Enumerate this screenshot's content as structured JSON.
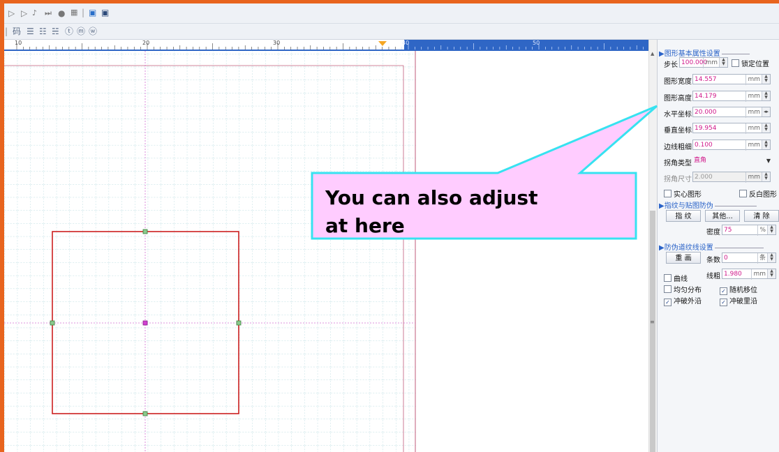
{
  "toolbar": {
    "row1_icons": [
      "play-outline-icon",
      "play-icon",
      "step-end-icon",
      "record-icon",
      "grid-icon",
      "image-icon",
      "image-dark-icon"
    ],
    "row2_icons": [
      "barcode-icon",
      "text-icon",
      "text-align-icon",
      "text-wrap-icon",
      "circle-t-icon",
      "circle-w-icon",
      "circle-m-icon"
    ],
    "row2_label_1": "码"
  },
  "ruler": {
    "labels": [
      "10",
      "20",
      "30",
      "40",
      "50"
    ]
  },
  "panel": {
    "basic_section": "图形基本属性设置",
    "step": {
      "label": "步长",
      "value": "100.000",
      "unit": "mm",
      "lock_label": "锁定位置"
    },
    "width": {
      "label": "图形宽度",
      "value": "14.557",
      "unit": "mm"
    },
    "height": {
      "label": "图形高度",
      "value": "14.179",
      "unit": "mm"
    },
    "hcoord": {
      "label": "水平坐标",
      "value": "20.000",
      "unit": "mm"
    },
    "vcoord": {
      "label": "垂直坐标",
      "value": "19.954",
      "unit": "mm"
    },
    "border": {
      "label": "边线粗细",
      "value": "0.100",
      "unit": "mm"
    },
    "corner_type": {
      "label": "拐角类型",
      "value": "直角"
    },
    "corner_size": {
      "label": "拐角尺寸",
      "value": "2.000",
      "unit": "mm"
    },
    "solid_label": "实心图形",
    "invert_label": "反白图形",
    "fingerprint_section": "指纹与贴图防伪",
    "fingerprint_btn": "指 纹",
    "other_btn": "其他...",
    "clear_btn": "清 除",
    "density": {
      "label": "密度",
      "value": "75",
      "unit": "%"
    },
    "guilloche_section": "防伪道纹线设置",
    "redraw_btn": "重 画",
    "count": {
      "label": "条数",
      "value": "0",
      "unit": "条"
    },
    "curve_label": "曲线",
    "thickness": {
      "label": "线粗",
      "value": "1.980",
      "unit": "mm"
    },
    "even_label": "均匀分布",
    "random_label": "随机移位",
    "break_outer_label": "冲破外沿",
    "break_inner_label": "冲破里沿",
    "checked_random": true,
    "checked_outer": true,
    "checked_inner": true
  },
  "callout": {
    "text_line1": "You can also adjust",
    "text_line2": "at here",
    "fill": "#ffccff",
    "border": "#37e2f0"
  },
  "colors": {
    "frame": "#e8641e",
    "ruler_active": "#2f66c5",
    "shape_stroke": "#cc1f1f",
    "handle": "#4caf50",
    "grid": "#9fd0d6"
  }
}
